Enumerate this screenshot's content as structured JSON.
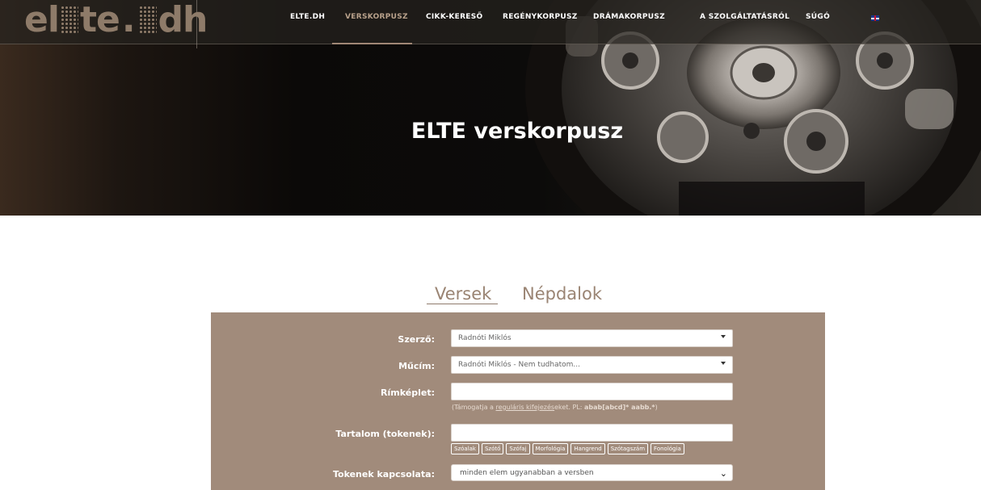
{
  "logo": {
    "text_left": "el",
    "text_mid": "te",
    "text_right": "dh"
  },
  "nav": {
    "items": [
      {
        "label": "ELTE.DH"
      },
      {
        "label": "VERSKORPUSZ"
      },
      {
        "label": "CIKK-KERESŐ"
      },
      {
        "label": "REGÉNYKORPUSZ"
      },
      {
        "label": "DRÁMAKORPUSZ"
      },
      {
        "label": "A SZOLGÁLTATÁSRÓL"
      },
      {
        "label": "SÚGÓ"
      }
    ],
    "active": "VERSKORPUSZ",
    "language": "English"
  },
  "hero": {
    "title": "ELTE verskorpusz"
  },
  "tabs": [
    {
      "label": "Versek",
      "active": true
    },
    {
      "label": "Népdalok",
      "active": false
    }
  ],
  "form": {
    "author": {
      "label": "Szerző:",
      "value": "Radnóti Miklós"
    },
    "work": {
      "label": "Műcím:",
      "value": "Radnóti Miklós - Nem tudhatom..."
    },
    "rhyme": {
      "label": "Rímképlet:",
      "value": "",
      "hint_prefix": "(Támogatja a ",
      "hint_link": "reguláris kifejezés",
      "hint_mid": "eket. PL: ",
      "hint_example": "abab[abcd]* aabb.*",
      "hint_suffix": ")"
    },
    "content": {
      "label": "Tartalom (tokenek):",
      "value": "",
      "token_buttons": [
        "Szóalak",
        "Szótő",
        "Szófaj",
        "Morfológia",
        "Hangrend",
        "Szótagszám",
        "Fonológia"
      ]
    },
    "relation": {
      "label": "Tokenek kapcsolata:",
      "value": "minden elem ugyanabban a versben"
    }
  },
  "colors": {
    "accent": "#a18b7b",
    "tab_text": "#9a8473",
    "nav_active": "#b8a18b"
  }
}
